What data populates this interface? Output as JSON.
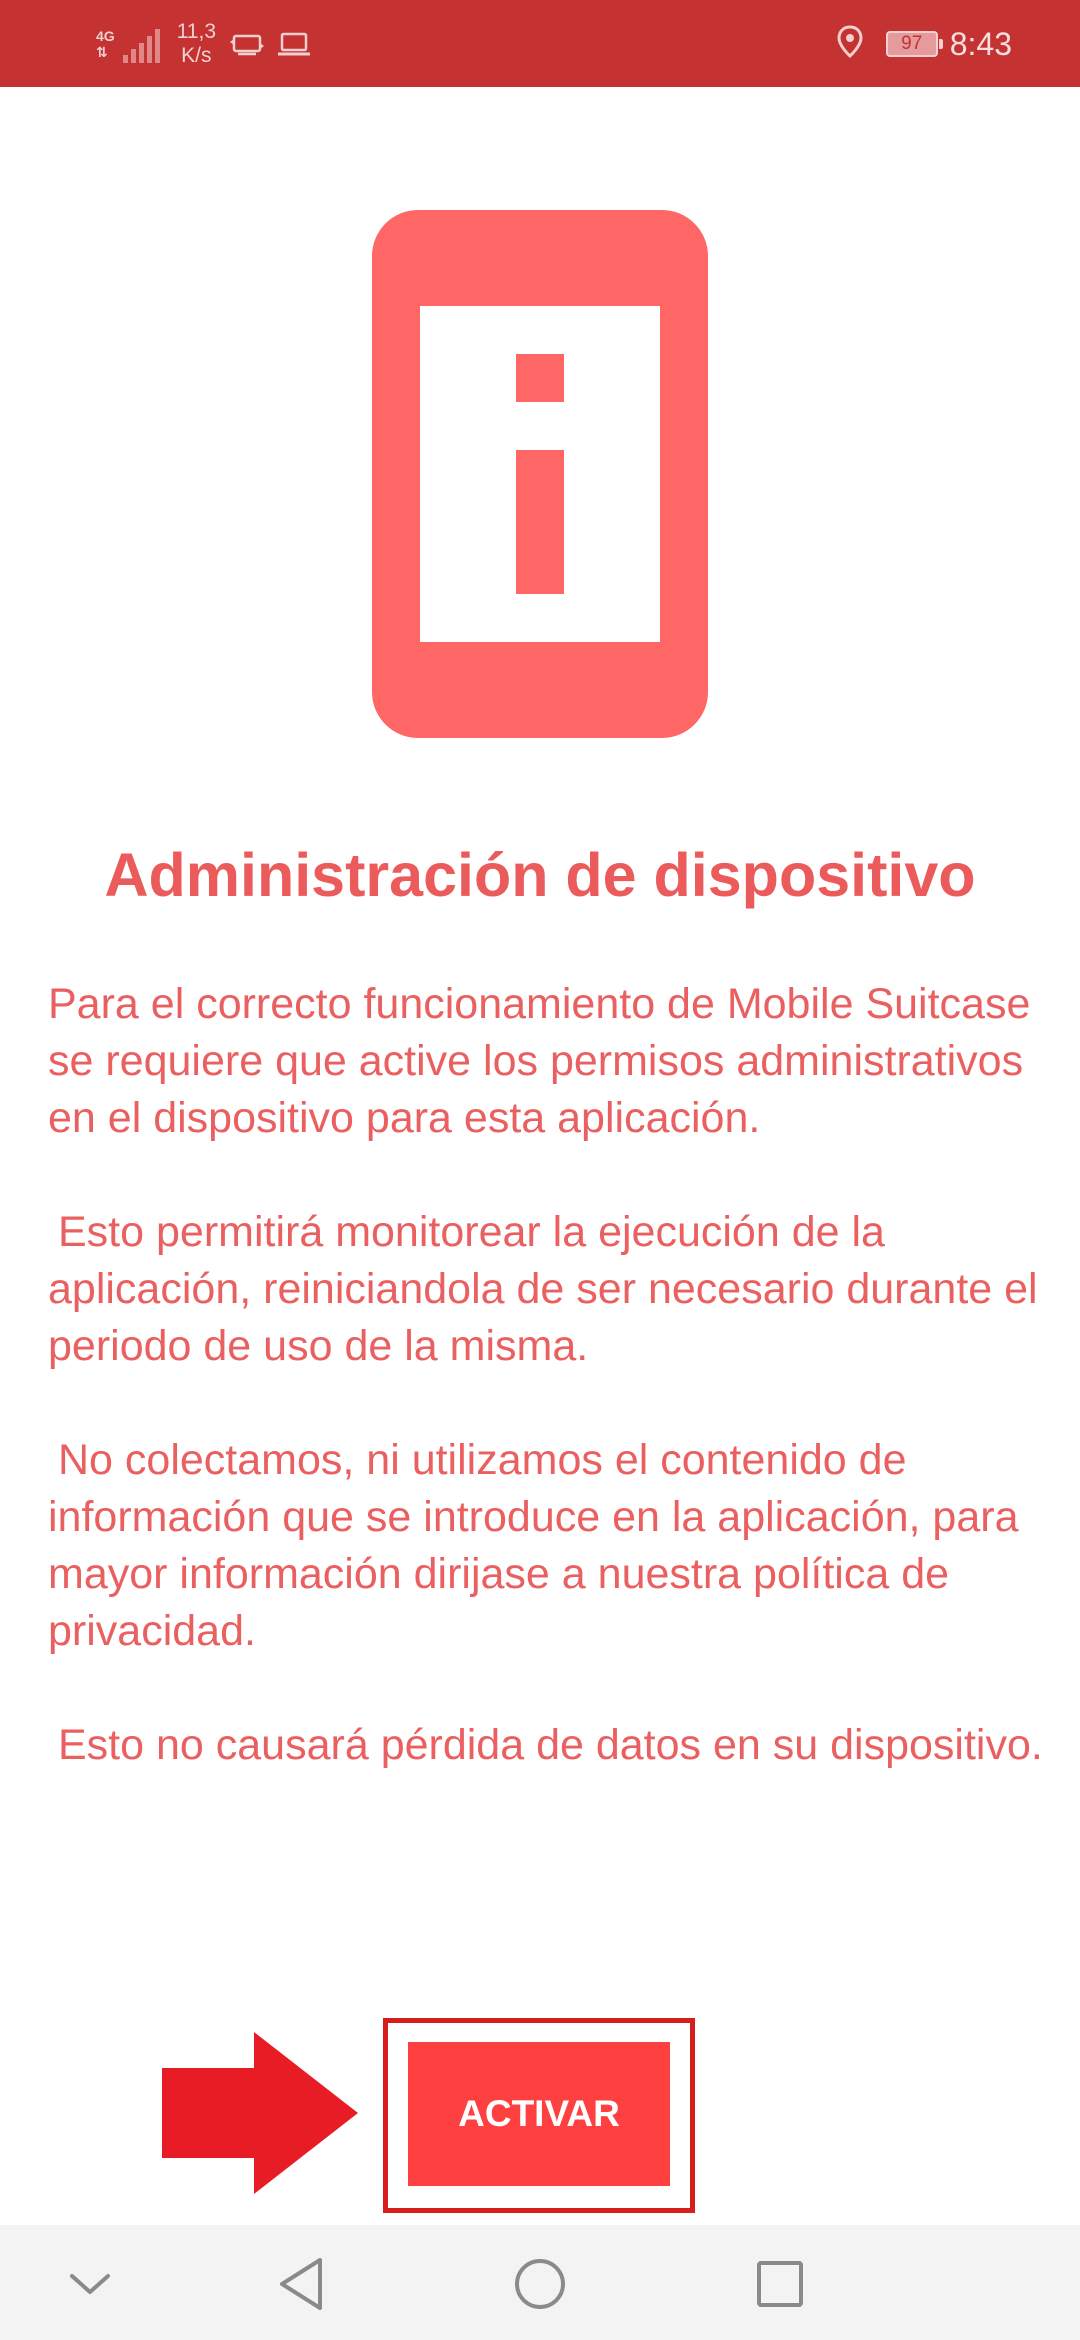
{
  "status_bar": {
    "network": "4G",
    "speed_value": "11,3",
    "speed_unit": "K/s",
    "battery": "97",
    "time": "8:43",
    "icons": [
      "signal-icon",
      "data-transfer-icon",
      "laptop-icon",
      "location-icon",
      "battery-icon"
    ]
  },
  "main": {
    "icon": "device-info-icon",
    "title": "Administración de dispositivo",
    "paragraphs": [
      "Para el correcto funcionamiento de Mobile Suitcase se requiere que active los permisos administrativos en el dispositivo para esta aplicación.",
      "Esto permitirá monitorear la ejecución de la aplicación, reiniciandola de ser necesario durante el periodo de uso de la misma.",
      "No colectamos, ni utilizamos el contenido de información que se introduce en la aplicación, para mayor información dirijase a nuestra política de privacidad.",
      "Esto no causará pérdida de datos en su dispositivo."
    ]
  },
  "actions": {
    "activate_label": "ACTIVAR"
  },
  "nav_bar": {
    "icons": [
      "collapse-icon",
      "back-icon",
      "home-icon",
      "recents-icon"
    ]
  },
  "colors": {
    "status_bar": "#c43232",
    "accent": "#ff6666",
    "title": "#ec5b5b",
    "body_text": "#ea6060",
    "button": "#ff4040",
    "annotation": "#e81c24"
  }
}
